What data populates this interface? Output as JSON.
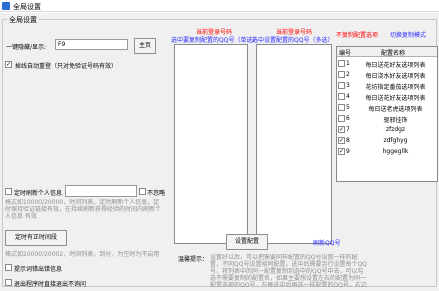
{
  "window": {
    "title": "全局设置"
  },
  "settings_group": {
    "title": "全局设置"
  },
  "login": {
    "label": "一键隐藏/显示:",
    "value": "F9",
    "button": "主页"
  },
  "auto_receive": {
    "label": "掉线自动重登（只对免验证号码有效）",
    "checked": true
  },
  "headers": {
    "left_title": "当前登录号码",
    "left_sub": "选中要复制配置的QQ号（单选）",
    "mid_title": "当前登录号码",
    "mid_sub": "选中设置配置的QQ号（多选）",
    "no_copy": "不复制配置选项",
    "toggle_mode": "切换复制模式"
  },
  "table": {
    "col_num": "编号",
    "col_name": "配置名称",
    "rows": [
      {
        "num": "1",
        "name": "每日送花好友选项列表",
        "checked": false
      },
      {
        "num": "2",
        "name": "每日浇水好友选项列表",
        "checked": false
      },
      {
        "num": "3",
        "name": "花坊指定番茄选项列表",
        "checked": false
      },
      {
        "num": "4",
        "name": "每日送花好友选项列表",
        "checked": false
      },
      {
        "num": "5",
        "name": "每日送老虎选项列表",
        "checked": false
      },
      {
        "num": "6",
        "name": "驱邪挂饰",
        "checked": false
      },
      {
        "num": "7",
        "name": "zfzdgz",
        "checked": true
      },
      {
        "num": "8",
        "name": "zdfghyg",
        "checked": true
      },
      {
        "num": "9",
        "name": "hggegllk",
        "checked": true
      }
    ]
  },
  "refresh": {
    "label": "定时刷新个人信息",
    "checked": false,
    "note_check": "不忽略",
    "hint": "格式如10000/20000，时间列表，定时刷新个人信息，定时保持验证链接有效，在持续刷新获得经验的时间内刷新个人信息 有效"
  },
  "timer": {
    "button": "定时有正时间段",
    "hint": "格式如20000/20002，时间列表，到分，为空时为不启用"
  },
  "options": [
    {
      "label": "提示词错出错信息",
      "checked": false
    },
    {
      "label": "退出程序时直接退出不询问",
      "checked": false
    }
  ],
  "apply_button": "设置配置",
  "refresh_qq": "刷新QQ号",
  "tip_label": "温馨提示：",
  "tip_text": "设置好以后，可以把需要同样配置的QQ号设置一样的配置，不同QQ号设置相同配置，选中后需要另行设置每个QQ号，将列表中的同一配置复制到选中的QQ号中去，可以勾选不需要复制的配置名，如果主要想设置左右的配置为同一配置选项的QQ号，左框选中后再选一样配置的QQ号，右边选中要复制这个QQ号的配置。"
}
